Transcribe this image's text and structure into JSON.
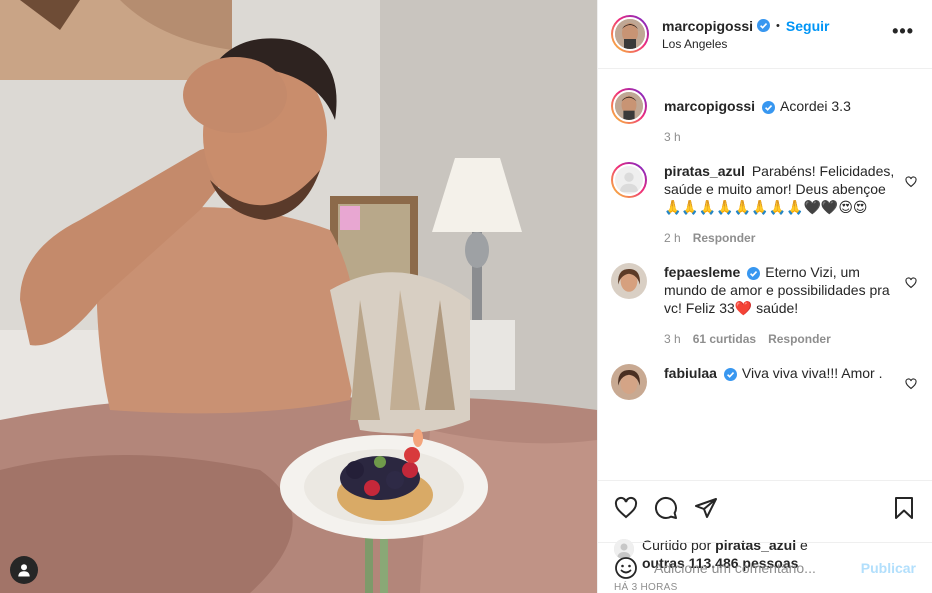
{
  "post": {
    "author": {
      "username": "marcopigossi",
      "verified": true,
      "location": "Los Angeles"
    },
    "follow_label": "Seguir",
    "more_label": "•••",
    "caption": {
      "username": "marcopigossi",
      "text": "Acordei 3.3",
      "time": "3 h"
    }
  },
  "comments": [
    {
      "username": "piratas_azul",
      "text": "Parabéns! Felicidades, saúde e muito amor! Deus abençoe 🙏🙏🙏🙏🙏🙏🙏🙏🖤🖤😍😍",
      "time": "2 h",
      "likes": "",
      "reply": "Responder"
    },
    {
      "username": "fepaesleme",
      "verified": true,
      "text": "Eterno Vizi, um mundo de amor e possibilidades pra vc! Feliz 33❤️ saúde!",
      "time": "3 h",
      "likes": "61 curtidas",
      "reply": "Responder"
    },
    {
      "username": "fabiulaa",
      "verified": true,
      "text": "Viva viva viva!!! Amor .",
      "time": "",
      "likes": "",
      "reply": ""
    }
  ],
  "likes": {
    "prefix": "Curtido por",
    "user": "piratas_azul",
    "conj": "e",
    "others": "outras 113.486 pessoas"
  },
  "timestamp": "HÁ 3 HORAS",
  "add_comment": {
    "placeholder": "Adicione um comentário...",
    "publish": "Publicar"
  },
  "colors": {
    "link": "#0095f6",
    "verified": "#3897f0",
    "muted": "#8e8e8e",
    "publish_disabled": "#b2dffc"
  }
}
